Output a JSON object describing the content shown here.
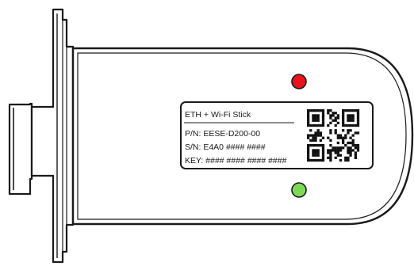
{
  "device": {
    "label": {
      "title": "ETH + Wi-Fi Stick",
      "part_number": "P/N: EESE-D200-00",
      "serial_number": "S/N: E4A0 #### ####",
      "key": "KEY: #### #### #### ####"
    },
    "leds": {
      "top": {
        "color": "#e8141b"
      },
      "bottom": {
        "color": "#7ed957"
      }
    },
    "qr_code": {
      "icon": "qr-code-icon"
    },
    "colors": {
      "outline": "#1a1a1a",
      "body_fill": "#ffffff"
    }
  }
}
